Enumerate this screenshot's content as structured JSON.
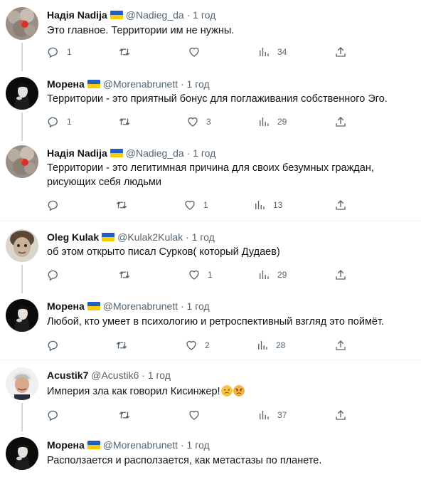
{
  "tweets": [
    {
      "name": "Надія Nadija",
      "handle": "@Nadieg_da",
      "sep": "·",
      "time": "1 год",
      "text": "Это главное. Территории им не нужны.",
      "replies": "1",
      "retweets": "",
      "likes": "",
      "views": "34",
      "avatar": "nadija-avatar"
    },
    {
      "name": "Морена",
      "handle": "@Morenabrunett",
      "sep": "·",
      "time": "1 год",
      "text": "Территории - это приятный бонус для поглаживания собственного Эго.",
      "replies": "1",
      "retweets": "",
      "likes": "3",
      "views": "29",
      "avatar": "morena-avatar"
    },
    {
      "name": "Надія Nadija",
      "handle": "@Nadieg_da",
      "sep": "·",
      "time": "1 год",
      "text": "Территории - это легитимная причина для своих безумных граждан, рисующих себя людьми",
      "replies": "",
      "retweets": "",
      "likes": "1",
      "views": "13",
      "avatar": "nadija-avatar"
    },
    {
      "name": "Oleg Kulak",
      "handle": "@Kulak2Kulak",
      "sep": "·",
      "time": "1 год",
      "text": "об этом открыто писал Сурков( который Дудаев)",
      "replies": "",
      "retweets": "",
      "likes": "1",
      "views": "29",
      "avatar": "oleg-avatar"
    },
    {
      "name": "Морена",
      "handle": "@Morenabrunett",
      "sep": "·",
      "time": "1 год",
      "text": "Любой, кто умеет в психологию и ретроспективный взгляд это поймёт.",
      "replies": "",
      "retweets": "",
      "likes": "2",
      "views": "28",
      "avatar": "morena-avatar"
    },
    {
      "name": "Acustik7",
      "handle": "@Acustik6",
      "sep": "·",
      "time": "1 год",
      "text": "Империя зла как говорил Кисинжер!",
      "replies": "",
      "retweets": "",
      "likes": "",
      "views": "37",
      "avatar": "acustik-avatar"
    },
    {
      "name": "Морена",
      "handle": "@Morenabrunett",
      "sep": "·",
      "time": "1 год",
      "text": "Расползается и расползается, как метастазы по планете.",
      "replies": "",
      "retweets": "",
      "likes": "",
      "views": "",
      "avatar": "morena-avatar"
    }
  ],
  "colors": {
    "text": "#0f1419",
    "muted": "#536471",
    "thread_line": "#cfd9de",
    "flag_blue": "#1f5fbf",
    "flag_yellow": "#f5cd00"
  },
  "icons": [
    "reply-icon",
    "retweet-icon",
    "like-icon",
    "views-icon",
    "share-icon"
  ]
}
